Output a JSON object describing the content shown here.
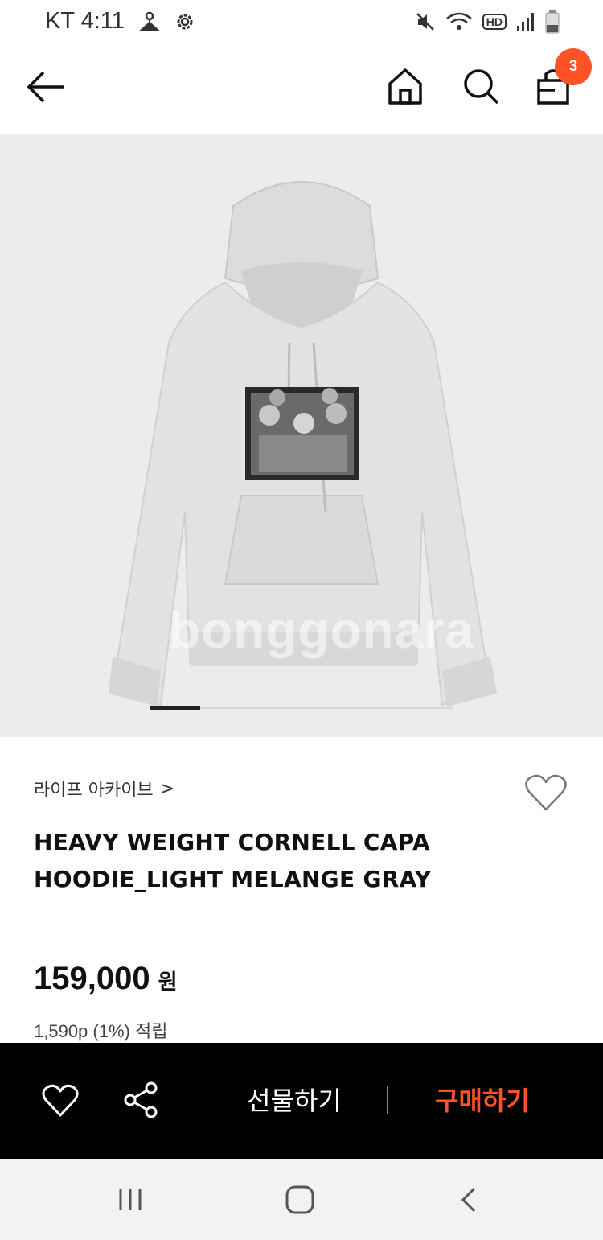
{
  "status_bar": {
    "carrier_time": "KT 4:11",
    "icons": [
      "hanger-icon",
      "gear-icon",
      "mute-icon",
      "wifi-icon",
      "hd-icon",
      "signal-icon",
      "battery-icon"
    ],
    "hd_label": "HD"
  },
  "header": {
    "back_icon": "arrow-left-icon",
    "home_icon": "home-icon",
    "search_icon": "search-icon",
    "cart_icon": "shopping-bag-icon",
    "cart_count": "3"
  },
  "product": {
    "watermark": "bonggonara",
    "image_count_active": 1,
    "brand": "라이프 아카이브",
    "brand_chevron": ">",
    "name": "HEAVY WEIGHT CORNELL CAPA HOODIE_LIGHT MELANGE GRAY",
    "price": "159,000",
    "currency": "원",
    "points": "1,590p (1%) 적립"
  },
  "bottom_bar": {
    "wish_icon": "heart-icon",
    "share_icon": "share-icon",
    "gift_label": "선물하기",
    "buy_label": "구매하기"
  },
  "colors": {
    "accent": "#ff5226",
    "bottom_bar_bg": "#000000",
    "image_bg": "#ececec"
  }
}
